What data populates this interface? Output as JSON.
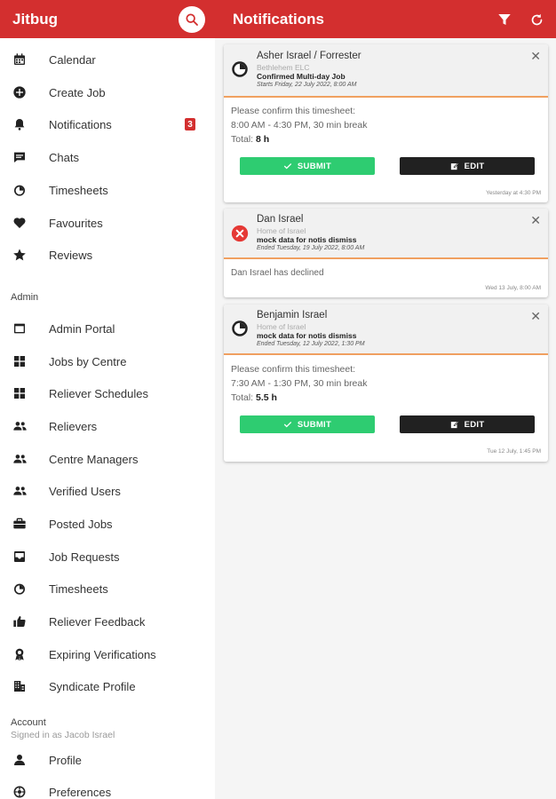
{
  "header": {
    "app_title": "Jitbug",
    "page_title": "Notifications"
  },
  "sidebar": {
    "items": [
      {
        "label": "Calendar",
        "icon": "calendar-icon"
      },
      {
        "label": "Create Job",
        "icon": "add-circle-icon"
      },
      {
        "label": "Notifications",
        "icon": "bell-icon",
        "badge": "3"
      },
      {
        "label": "Chats",
        "icon": "chat-icon"
      },
      {
        "label": "Timesheets",
        "icon": "timer-icon"
      },
      {
        "label": "Favourites",
        "icon": "heart-icon"
      },
      {
        "label": "Reviews",
        "icon": "star-icon"
      }
    ],
    "admin_label": "Admin",
    "admin_items": [
      {
        "label": "Admin Portal",
        "icon": "portal-icon"
      },
      {
        "label": "Jobs by Centre",
        "icon": "grid-icon"
      },
      {
        "label": "Reliever Schedules",
        "icon": "grid-icon"
      },
      {
        "label": "Relievers",
        "icon": "people-icon"
      },
      {
        "label": "Centre Managers",
        "icon": "people-icon"
      },
      {
        "label": "Verified Users",
        "icon": "people-icon"
      },
      {
        "label": "Posted Jobs",
        "icon": "briefcase-icon"
      },
      {
        "label": "Job Requests",
        "icon": "inbox-icon"
      },
      {
        "label": "Timesheets",
        "icon": "timer-icon"
      },
      {
        "label": "Reliever Feedback",
        "icon": "thumbs-up-icon"
      },
      {
        "label": "Expiring Verifications",
        "icon": "award-icon"
      },
      {
        "label": "Syndicate Profile",
        "icon": "building-icon"
      }
    ],
    "account_label": "Account",
    "signed_in": "Signed in as Jacob Israel",
    "account_items": [
      {
        "label": "Profile",
        "icon": "person-icon"
      },
      {
        "label": "Preferences",
        "icon": "settings-icon"
      }
    ]
  },
  "notifications": [
    {
      "name": "Asher Israel / Forrester",
      "place": "Bethlehem ELC",
      "headline": "Confirmed Multi-day Job",
      "date": "Starts Friday, 22 July 2022, 8:00 AM",
      "body1": "Please confirm this timesheet:",
      "body2": "8:00 AM - 4:30 PM, 30 min break",
      "total_label": "Total:",
      "total_value": "8 h",
      "submit_label": "SUBMIT",
      "edit_label": "EDIT",
      "time": "Yesterday at 4:30 PM"
    },
    {
      "name": "Dan Israel",
      "place": "Home of Israel",
      "headline": "mock data for notis dismiss",
      "date": "Ended Tuesday, 19 July 2022, 8:00 AM",
      "body1": "Dan Israel has declined",
      "time": "Wed 13 July, 8:00 AM"
    },
    {
      "name": "Benjamin Israel",
      "place": "Home of Israel",
      "headline": "mock data for notis dismiss",
      "date": "Ended Tuesday, 12 July 2022, 1:30 PM",
      "body1": "Please confirm this timesheet:",
      "body2": "7:30 AM - 1:30 PM, 30 min break",
      "total_label": "Total:",
      "total_value": "5.5 h",
      "submit_label": "SUBMIT",
      "edit_label": "EDIT",
      "time": "Tue 12 July, 1:45 PM"
    }
  ],
  "colors": {
    "brand": "#d32f2f",
    "submit": "#2ecc71",
    "edit": "#212121",
    "declined": "#e53935",
    "divider": "#f0a060"
  }
}
